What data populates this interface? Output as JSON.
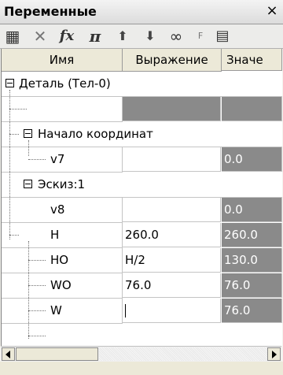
{
  "panel": {
    "title": "Переменные",
    "close_glyph": "×"
  },
  "toolbar": {
    "items": [
      {
        "icon": "table-icon",
        "glyph": "▦"
      },
      {
        "icon": "delete-icon",
        "glyph": "✕"
      },
      {
        "icon": "function-icon",
        "glyph": "fx"
      },
      {
        "icon": "pi-icon",
        "glyph": "π"
      },
      {
        "icon": "arrow-up-icon",
        "glyph": "⬆"
      },
      {
        "icon": "arrow-down-icon",
        "glyph": "⬇"
      },
      {
        "icon": "link-icon",
        "glyph": "∞"
      },
      {
        "icon": "formula-icon",
        "glyph": "F"
      },
      {
        "icon": "table-settings-icon",
        "glyph": "▤"
      }
    ]
  },
  "columns": {
    "name": "Имя",
    "expression": "Выражение",
    "value": "Значе"
  },
  "tree": {
    "part": "Деталь (Тел-0)",
    "origin": "Начало координат",
    "sketch": "Эскиз:1"
  },
  "rows": {
    "v7": {
      "name": "v7",
      "expression": "",
      "value": "0.0"
    },
    "v8": {
      "name": "v8",
      "expression": "",
      "value": "0.0"
    },
    "H": {
      "name": "H",
      "expression": "260.0",
      "value": "260.0"
    },
    "HO": {
      "name": "HO",
      "expression": "H/2",
      "value": "130.0"
    },
    "WO": {
      "name": "WO",
      "expression": "76.0",
      "value": "76.0"
    },
    "W": {
      "name": "W",
      "expression": "",
      "value": "76.0"
    }
  },
  "colors": {
    "grid_dark": "#8a8a8a",
    "header_bg": "#ece9d8"
  }
}
